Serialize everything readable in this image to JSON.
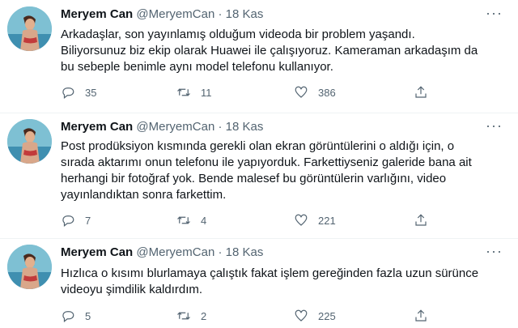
{
  "tweets": [
    {
      "author": "Meryem Can",
      "handle": "@MeryemCan",
      "separator": "·",
      "time": "18 Kas",
      "more": "···",
      "lines": [
        "Arkadaşlar, son yayınlamış olduğum videoda bir problem yaşandı.",
        "Biliyorsunuz biz ekip olarak Huawei ile çalışıyoruz. Kameraman arkadaşım da",
        "bu sebeple benimle aynı model telefonu kullanıyor."
      ],
      "replies": "35",
      "retweets": "11",
      "likes": "386"
    },
    {
      "author": "Meryem Can",
      "handle": "@MeryemCan",
      "separator": "·",
      "time": "18 Kas",
      "more": "···",
      "lines": [
        "Post prodüksiyon kısmında gerekli olan ekran görüntülerini o aldığı için, o",
        "sırada aktarımı onun telefonu ile yapıyorduk. Farkettiyseniz galeride bana ait",
        "herhangi bir fotoğraf yok. Bende malesef bu görüntülerin varlığını, video",
        "yayınlandıktan sonra farkettim."
      ],
      "replies": "7",
      "retweets": "4",
      "likes": "221"
    },
    {
      "author": "Meryem Can",
      "handle": "@MeryemCan",
      "separator": "·",
      "time": "18 Kas",
      "more": "···",
      "lines": [
        "Hızlıca o kısımı blurlamaya çalıştık fakat işlem gereğinden fazla uzun sürünce",
        "videoyu şimdilik kaldırdım."
      ],
      "replies": "5",
      "retweets": "2",
      "likes": "225"
    }
  ],
  "icons": {
    "reply": "reply-icon",
    "retweet": "retweet-icon",
    "like": "heart-icon",
    "share": "share-icon",
    "more": "more-icon"
  },
  "colors": {
    "text": "#0f1419",
    "secondary": "#536471",
    "divider": "#eff3f4"
  }
}
